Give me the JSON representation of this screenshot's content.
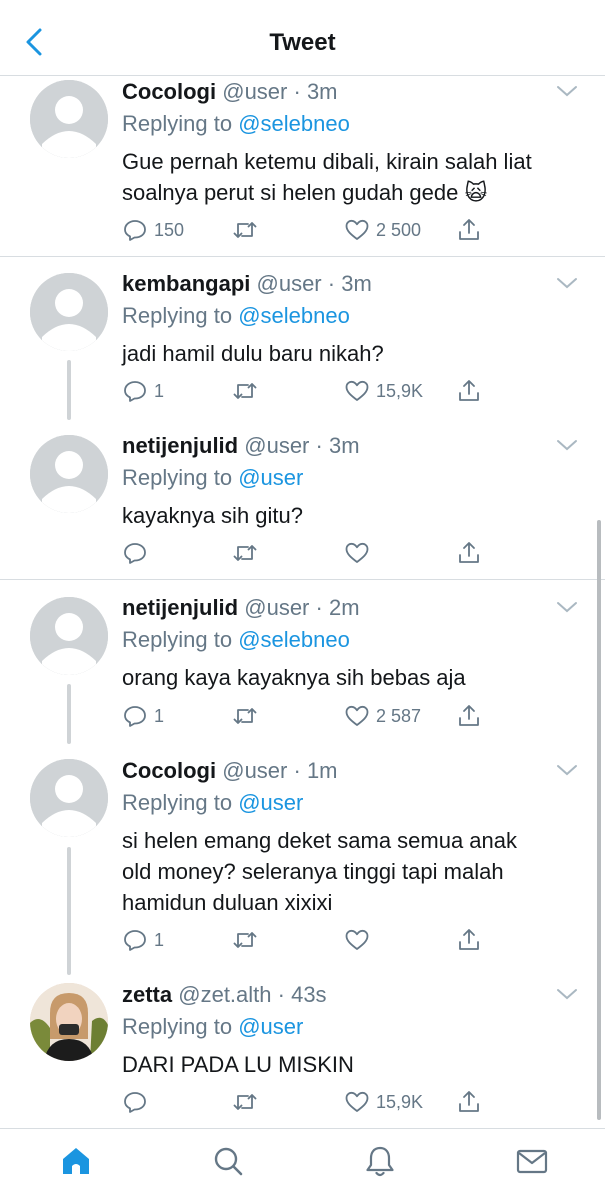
{
  "header": {
    "title": "Tweet"
  },
  "colors": {
    "accent": "#1b95e0",
    "secondary_text": "#657786",
    "primary_text": "#14171a"
  },
  "tweets": [
    {
      "name": "Cocologi",
      "handle": "@user",
      "time": "· 3m",
      "replying_label": "Replying to",
      "replying_to": "@selebneo",
      "lines": [
        "Gue pernah ketemu dibali, kirain salah liat",
        "soalnya perut si helen gudah gede 🙀"
      ],
      "reply_count": "150",
      "retweet_count": "",
      "like_count": "2 500"
    },
    {
      "name": "kembangapi",
      "handle": "@user",
      "time": "· 3m",
      "replying_label": "Replying to",
      "replying_to": "@selebneo",
      "lines": [
        "jadi hamil dulu baru nikah?"
      ],
      "reply_count": "1",
      "retweet_count": "",
      "like_count": "15,9K"
    },
    {
      "name": "netijenjulid",
      "handle": "@user",
      "time": "· 3m",
      "replying_label": "Replying to",
      "replying_to": "@user",
      "lines": [
        "kayaknya sih gitu?"
      ],
      "reply_count": "",
      "retweet_count": "",
      "like_count": ""
    },
    {
      "name": "netijenjulid",
      "handle": "@user",
      "time": "· 2m",
      "replying_label": "Replying to",
      "replying_to": "@selebneo",
      "lines": [
        "orang kaya kayaknya sih bebas aja"
      ],
      "reply_count": "1",
      "retweet_count": "",
      "like_count": "2 587"
    },
    {
      "name": "Cocologi",
      "handle": "@user",
      "time": "· 1m",
      "replying_label": "Replying to",
      "replying_to": "@user",
      "lines": [
        "si helen emang deket sama semua anak",
        "old money? seleranya tinggi tapi malah",
        "hamidun duluan xixixi"
      ],
      "reply_count": "1",
      "retweet_count": "",
      "like_count": ""
    },
    {
      "name": "zetta",
      "handle": "@zet.alth",
      "time": "· 43s",
      "replying_label": "Replying to",
      "replying_to": "@user",
      "lines": [
        "DARI PADA LU MISKIN"
      ],
      "reply_count": "",
      "retweet_count": "",
      "like_count": "15,9K"
    }
  ],
  "icons": {
    "back": "chevron-left-icon",
    "more": "chevron-down-icon",
    "reply": "reply-icon",
    "retweet": "retweet-icon",
    "like": "heart-icon",
    "share": "share-icon",
    "home": "home-icon",
    "search": "search-icon",
    "notifications": "bell-icon",
    "messages": "mail-icon"
  }
}
